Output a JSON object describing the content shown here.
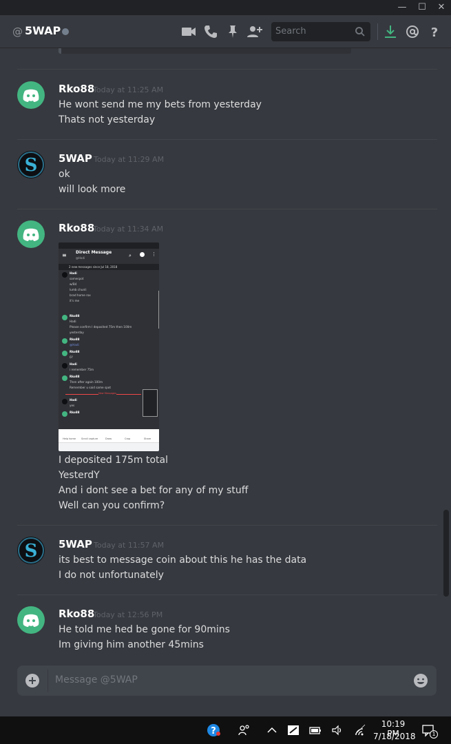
{
  "window": {
    "minimize": "—",
    "maximize": "☐",
    "close": "✕"
  },
  "header": {
    "at": "@",
    "channel_name": "5WAP",
    "search_placeholder": "Search",
    "icons": [
      "video-call-icon",
      "voice-call-icon",
      "pin-icon",
      "add-friend-icon",
      "search-icon",
      "download-icon",
      "mention-icon",
      "help-icon"
    ]
  },
  "colors": {
    "background": "#36393f",
    "discord_green": "#43b581",
    "download_green": "#43b581",
    "username": "#ffffff",
    "timestamp": "#5f6269"
  },
  "messages": [
    {
      "author": "Rko88",
      "timestamp": "Today at 11:25 AM",
      "avatar": "discord-logo-avatar",
      "lines": [
        "He wont send me my bets from yesterday",
        "Thats not yesterday"
      ]
    },
    {
      "author": "5WAP",
      "timestamp": "Today at 11:29 AM",
      "avatar": "5wap-logo-avatar",
      "lines": [
        "ok",
        "will look more"
      ]
    },
    {
      "author": "Rko88",
      "timestamp": "Today at 11:34 AM",
      "avatar": "discord-logo-avatar",
      "attachment": {
        "title": "Direct Message",
        "subtitle": "@Hadi",
        "new_bar": "2 new messages since Jul 18, 2018",
        "rows": [
          {
            "name": "Hadi",
            "text": [
              "samespot",
              "w/B4",
              "lumb chunli",
              "brad home rox",
              "it's me"
            ]
          },
          {
            "name": "Rko88",
            "text": [
              "Hadi",
              "Please confirm I deposited 75m then 100m",
              "yesterday"
            ]
          },
          {
            "name": "Rko88",
            "text": [
              "@Hadi"
            ]
          },
          {
            "name": "Rko88",
            "text": [
              "0?"
            ]
          },
          {
            "name": "Hadi",
            "text": [
              "i remember 75m"
            ]
          },
          {
            "name": "Rko88",
            "text": [
              "Then after again 100m",
              "Remember u said same spot"
            ]
          },
          {
            "name": "Hadi",
            "text": [
              "yes"
            ]
          },
          {
            "name": "Rko88",
            "text": [
              ""
            ]
          }
        ],
        "new_messages_label": "New Messages",
        "nav_items": [
          "Help home",
          "Scroll capture",
          "Draw",
          "Crop",
          "Share"
        ]
      },
      "lines": [
        "I deposited 175m total",
        "YesterdY",
        "And i dont see a bet for any of my stuff",
        "Well can you confirm?"
      ]
    },
    {
      "author": "5WAP",
      "timestamp": "Today at 11:57 AM",
      "avatar": "5wap-logo-avatar",
      "lines": [
        "its best to message coin about this he has the data",
        "I do not unfortunately"
      ]
    },
    {
      "author": "Rko88",
      "timestamp": "Today at 12:56 PM",
      "avatar": "discord-logo-avatar",
      "lines": [
        "He told me hed be gone for 90mins",
        "Im giving him another 45mins"
      ]
    }
  ],
  "composer": {
    "placeholder": "Message @5WAP"
  },
  "taskbar": {
    "time": "10:19 PM",
    "date": "7/18/2018",
    "notification_count": "1"
  }
}
